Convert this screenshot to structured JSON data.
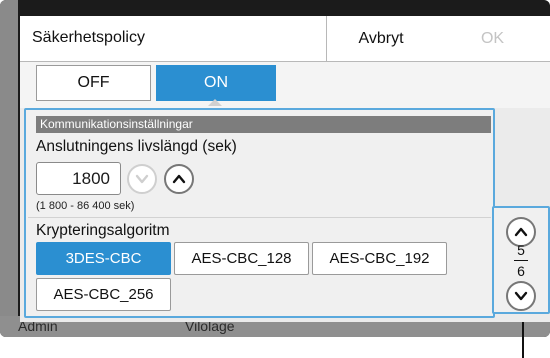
{
  "background": {
    "user_label": "Admin",
    "middle_label": "Vilolage"
  },
  "dialog": {
    "title": "Säkerhetspolicy",
    "cancel_label": "Avbryt",
    "ok_label": "OK",
    "ok_enabled": false
  },
  "toggle": {
    "off_label": "OFF",
    "on_label": "ON",
    "selected": "ON"
  },
  "section": {
    "header": "Kommunikationsinställningar",
    "lifetime_label": "Anslutningens livslängd (sek)",
    "lifetime_value": "1800",
    "lifetime_range": "(1 800 - 86 400 sek)",
    "algorithm_label": "Krypteringsalgoritm",
    "algorithms": [
      "3DES-CBC",
      "AES-CBC_128",
      "AES-CBC_192",
      "AES-CBC_256"
    ],
    "selected_algorithm": "3DES-CBC"
  },
  "pager": {
    "current": "5",
    "total": "6"
  },
  "colors": {
    "accent": "#2b8fd1",
    "focus_border": "#5aa9dd",
    "section_header": "#7d7d7d"
  }
}
